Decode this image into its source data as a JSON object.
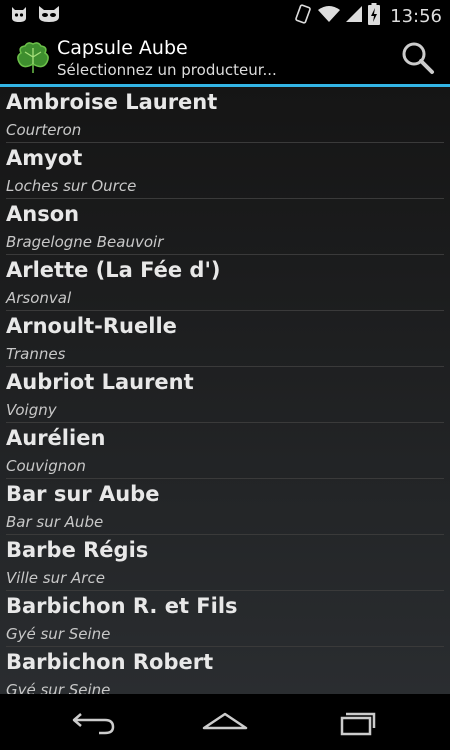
{
  "status_bar": {
    "time": "13:56",
    "left_icons": [
      "ghost-cat-icon",
      "cat-mask-icon"
    ],
    "right_icons": [
      "rotate-icon",
      "wifi-icon",
      "signal-icon",
      "battery-charging-icon"
    ]
  },
  "app_bar": {
    "title": "Capsule Aube",
    "subtitle": "Sélectionnez un producteur...",
    "logo_icon": "grape-leaf-icon",
    "search_icon": "search-icon",
    "accent": "#33b5e5"
  },
  "producers": [
    {
      "name": "Ambroise Laurent",
      "town": "Courteron"
    },
    {
      "name": "Amyot",
      "town": "Loches sur Ource"
    },
    {
      "name": "Anson",
      "town": "Bragelogne Beauvoir"
    },
    {
      "name": "Arlette (La Fée d')",
      "town": "Arsonval"
    },
    {
      "name": "Arnoult-Ruelle",
      "town": "Trannes"
    },
    {
      "name": "Aubriot Laurent",
      "town": "Voigny"
    },
    {
      "name": "Aurélien",
      "town": "Couvignon"
    },
    {
      "name": "Bar sur Aube",
      "town": "Bar sur Aube"
    },
    {
      "name": "Barbe Régis",
      "town": "Ville sur Arce"
    },
    {
      "name": "Barbichon R. et Fils",
      "town": "Gyé sur Seine"
    },
    {
      "name": "Barbichon Robert",
      "town": "Gyé sur Seine"
    }
  ],
  "nav_bar": {
    "back_icon": "back-icon",
    "home_icon": "home-icon",
    "recents_icon": "recents-icon"
  }
}
